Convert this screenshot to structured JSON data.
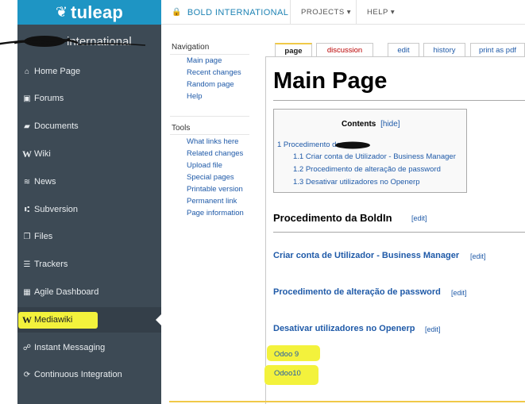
{
  "brand": {
    "logo_text": "tuleap",
    "logo_icon": "tuleap-leaf-icon"
  },
  "sidebar": {
    "project_name": "international",
    "items": [
      {
        "label": "Home Page",
        "icon": "home-icon",
        "glyph": "⌂"
      },
      {
        "label": "Forums",
        "icon": "forums-icon",
        "glyph": "▣"
      },
      {
        "label": "Documents",
        "icon": "folder-icon",
        "glyph": "▰"
      },
      {
        "label": "Wiki",
        "icon": "wiki-icon",
        "glyph": "W"
      },
      {
        "label": "News",
        "icon": "rss-icon",
        "glyph": "≋"
      },
      {
        "label": "Subversion",
        "icon": "subversion-icon",
        "glyph": "⑆"
      },
      {
        "label": "Files",
        "icon": "files-icon",
        "glyph": "❐"
      },
      {
        "label": "Trackers",
        "icon": "list-icon",
        "glyph": "☰"
      },
      {
        "label": "Agile Dashboard",
        "icon": "table-icon",
        "glyph": "▦"
      },
      {
        "label": "Mediawiki",
        "icon": "mediawiki-icon",
        "glyph": "W"
      },
      {
        "label": "Instant Messaging",
        "icon": "chat-icon",
        "glyph": "☍"
      },
      {
        "label": "Continuous Integration",
        "icon": "refresh-icon",
        "glyph": "⟳"
      }
    ]
  },
  "topbar": {
    "project": "BOLD INTERNATIONAL",
    "projects_menu": "PROJECTS",
    "help_menu": "HELP",
    "caret": "▾"
  },
  "wiki_nav": {
    "navigation_heading": "Navigation",
    "navigation_links": [
      "Main page",
      "Recent changes",
      "Random page",
      "Help"
    ],
    "tools_heading": "Tools",
    "tools_links": [
      "What links here",
      "Related changes",
      "Upload file",
      "Special pages",
      "Printable version",
      "Permanent link",
      "Page information"
    ]
  },
  "tabs": {
    "page": "page",
    "discussion": "discussion",
    "edit": "edit",
    "history": "history",
    "print": "print as pdf"
  },
  "article": {
    "title": "Main Page",
    "toc": {
      "title": "Contents",
      "hide": "[hide]",
      "items": [
        "1 Procedimento da",
        "1.1 Criar conta de Utilizador - Business Manager",
        "1.2 Procedimento de alteração de password",
        "1.3 Desativar utilizadores no Openerp"
      ]
    },
    "section": "Procedimento da BoldIn",
    "subsections": [
      "Criar conta de Utilizador - Business Manager",
      "Procedimento de alteração de password",
      "Desativar utilizadores no Openerp"
    ],
    "edit_label": "[edit]",
    "links": [
      "Odoo 9",
      "Odoo10"
    ]
  },
  "colors": {
    "sidebar": "#3d4a55",
    "brand": "#1e95c4",
    "link": "#1f5aa8",
    "highlight": "#f3f23c"
  }
}
